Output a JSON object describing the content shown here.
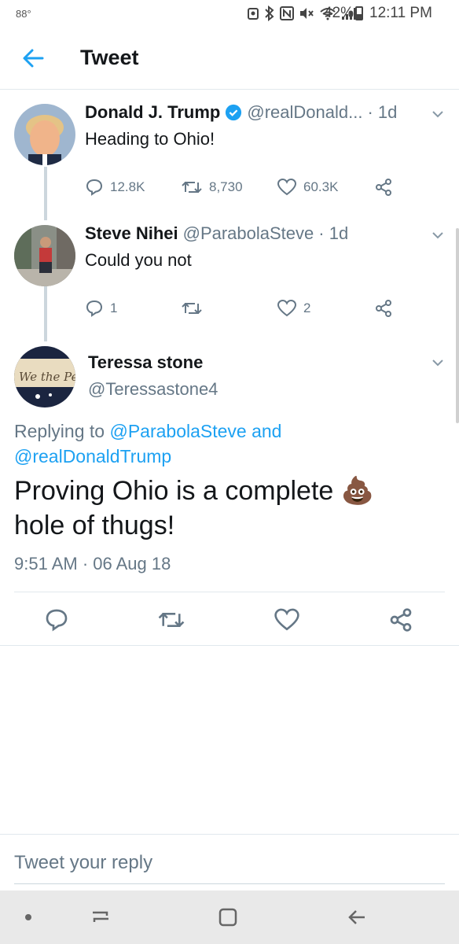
{
  "status_bar": {
    "temperature": "88°",
    "battery": "42%",
    "time": "12:11 PM"
  },
  "header": {
    "title": "Tweet"
  },
  "tweets": [
    {
      "name": "Donald J. Trump",
      "handle": "@realDonald...",
      "time": "· 1d",
      "text": "Heading to Ohio!",
      "replies": "12.8K",
      "retweets": "8,730",
      "likes": "60.3K"
    },
    {
      "name": "Steve Nihei",
      "handle": "@ParabolaSteve",
      "time": "· 1d",
      "text": "Could you not",
      "replies": "1",
      "retweets": "",
      "likes": "2"
    }
  ],
  "focused": {
    "name": "Teressa stone",
    "handle": "@Teressastone4",
    "replying_prefix": "Replying to ",
    "replying_user1": "@ParabolaSteve",
    "replying_and": " and",
    "replying_user2": "@realDonaldTrump",
    "text": "Proving Ohio is a complete 💩 hole of thugs!",
    "timestamp": "9:51 AM · 06 Aug 18"
  },
  "reply_bar": {
    "placeholder": "Tweet your reply"
  },
  "colors": {
    "accent": "#1da1f2",
    "muted": "#657786",
    "text": "#14171a"
  }
}
